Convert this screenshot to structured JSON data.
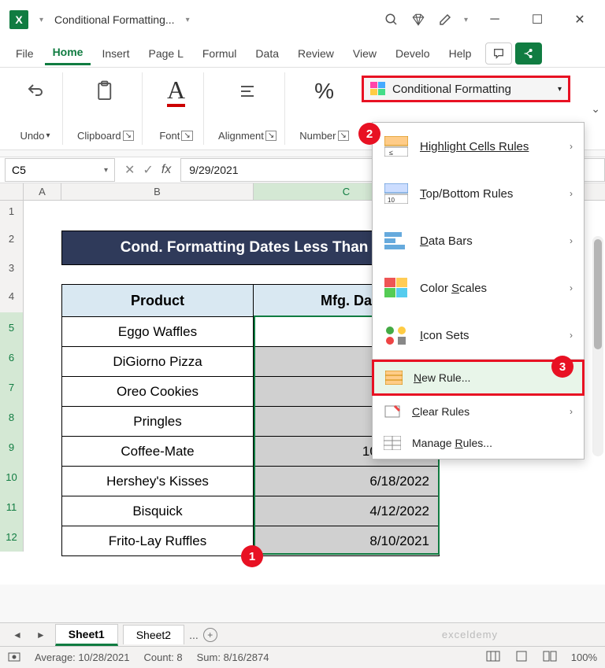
{
  "titlebar": {
    "doc_title": "Conditional Formatting..."
  },
  "tabs": {
    "file": "File",
    "home": "Home",
    "insert": "Insert",
    "pagel": "Page L",
    "formul": "Formul",
    "data": "Data",
    "review": "Review",
    "view": "View",
    "develo": "Develo",
    "help": "Help"
  },
  "ribbon": {
    "undo": "Undo",
    "clipboard": "Clipboard",
    "font": "Font",
    "alignment": "Alignment",
    "number": "Number",
    "cond_fmt": "Conditional Formatting"
  },
  "dropdown": {
    "highlight": "Highlight Cells Rules",
    "topbottom": "Top/Bottom Rules",
    "databars": "Data Bars",
    "colorscales": "Color Scales",
    "iconsets": "Icon Sets",
    "newrule": "New Rule...",
    "clearrules": "Clear Rules",
    "managerules": "Manage Rules..."
  },
  "namebox": "C5",
  "formula": "9/29/2021",
  "cols": {
    "a": "A",
    "b": "B",
    "c": "C"
  },
  "rows": [
    "1",
    "2",
    "3",
    "4",
    "5",
    "6",
    "7",
    "8",
    "9",
    "10",
    "11",
    "12"
  ],
  "table": {
    "title": "Cond. Formatting Dates Less Than 6 ",
    "hdr_product": "Product",
    "hdr_date": "Mfg. Da",
    "rows": [
      {
        "product": "Eggo Waffles",
        "date": ""
      },
      {
        "product": "DiGiorno Pizza",
        "date": ""
      },
      {
        "product": "Oreo Cookies",
        "date": ""
      },
      {
        "product": "Pringles",
        "date": ""
      },
      {
        "product": "Coffee-Mate",
        "date": "10/14/2020"
      },
      {
        "product": "Hershey's Kisses",
        "date": "6/18/2022"
      },
      {
        "product": "Bisquick",
        "date": "4/12/2022"
      },
      {
        "product": "Frito-Lay Ruffles",
        "date": "8/10/2021"
      }
    ]
  },
  "sheets": {
    "s1": "Sheet1",
    "s2": "Sheet2",
    "more": "..."
  },
  "status": {
    "avg": "Average: 10/28/2021",
    "count": "Count: 8",
    "sum": "Sum: 8/16/2874",
    "zoom": "100%"
  },
  "callouts": {
    "c1": "1",
    "c2": "2",
    "c3": "3"
  },
  "watermark": "exceldemy"
}
